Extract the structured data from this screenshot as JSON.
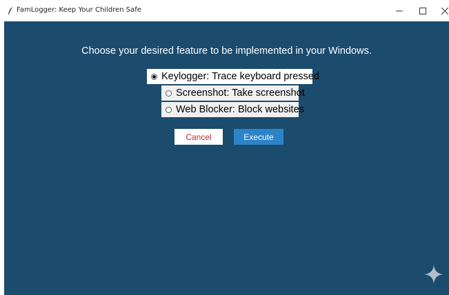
{
  "window": {
    "title": "FamLogger: Keep Your Children Safe",
    "controls": {
      "minimize": "minimize-icon",
      "maximize": "maximize-icon",
      "close": "close-icon"
    }
  },
  "main": {
    "prompt": "Choose your desired feature to be implemented in your Windows.",
    "options": [
      {
        "label": "Keylogger: Trace keyboard pressed",
        "selected": true
      },
      {
        "label": "Screenshot: Take screenshot",
        "selected": false
      },
      {
        "label": "Web Blocker: Block websites",
        "selected": false
      }
    ],
    "buttons": {
      "cancel": "Cancel",
      "execute": "Execute"
    }
  },
  "colors": {
    "background": "#1b4b6d",
    "execute_button": "#2d83c8",
    "cancel_text": "#c0272d"
  },
  "icons": {
    "app": "feather-icon",
    "corner": "sparkle-icon"
  }
}
